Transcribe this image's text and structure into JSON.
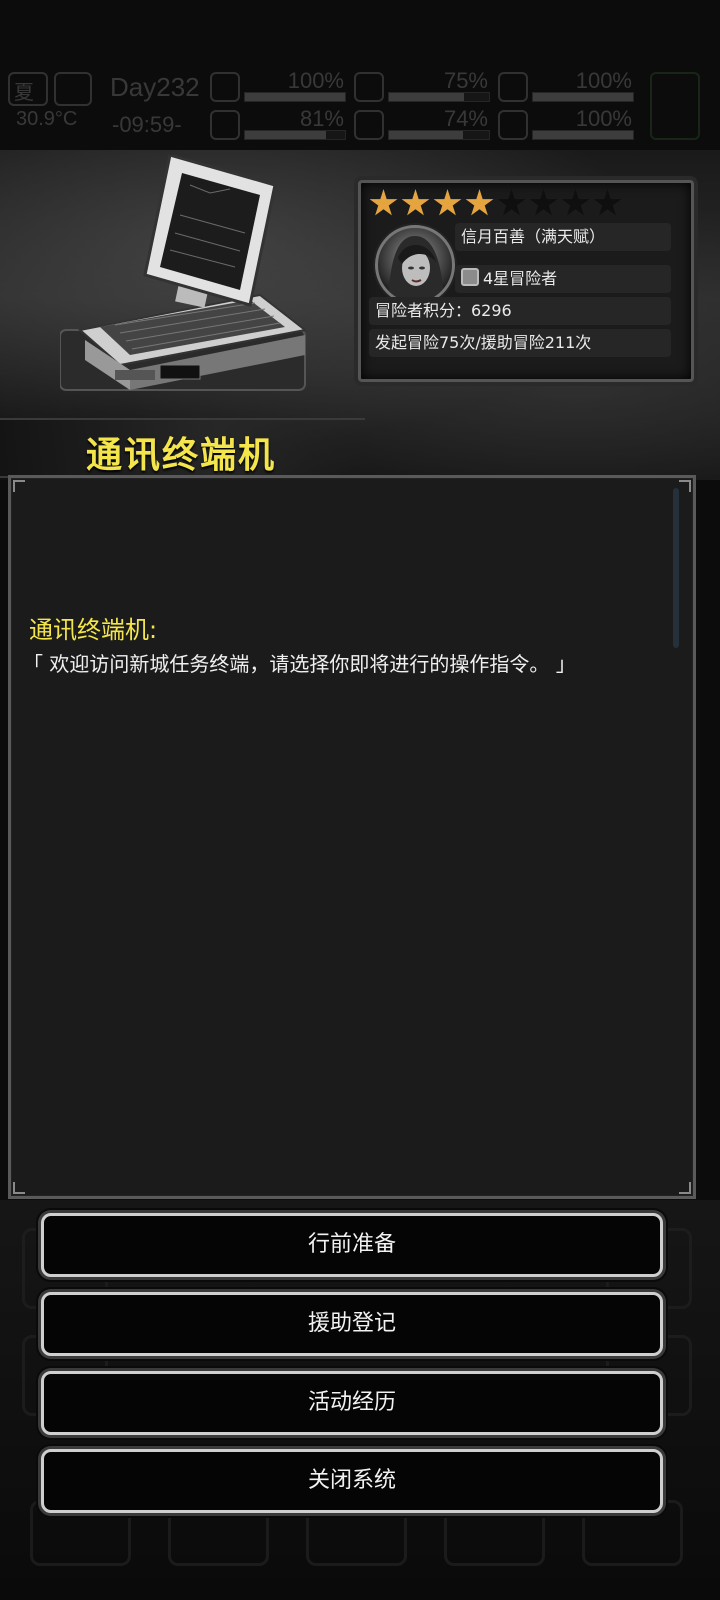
{
  "status_bar": {
    "season": "夏",
    "temperature": "30.9°C",
    "day": "Day232",
    "time": "-09:59-",
    "stats": [
      {
        "icon": "medkit-icon",
        "value": "100%",
        "level": 1.0
      },
      {
        "icon": "stomach-icon",
        "value": "75%",
        "level": 0.75
      },
      {
        "icon": "sleep-icon",
        "value": "100%",
        "level": 1.0
      },
      {
        "icon": "boot-icon",
        "value": "81%",
        "level": 0.81
      },
      {
        "icon": "water-drop-icon",
        "value": "74%",
        "level": 0.74
      },
      {
        "icon": "heart-icon",
        "value": "100%",
        "level": 1.0
      }
    ]
  },
  "profile": {
    "stars_total": 8,
    "stars_filled": 4,
    "name": "信月百善（满天赋）",
    "rank": "4星冒险者",
    "score_text": "冒险者积分：6296",
    "missions_text": "发起冒险75次/援助冒险211次"
  },
  "terminal": {
    "title": "通讯终端机",
    "speaker": "通讯终端机:",
    "message": "「 欢迎访问新城任务终端，请选择你即将进行的操作指令。 」"
  },
  "actions": [
    {
      "label": "行前准备"
    },
    {
      "label": "援助登记"
    },
    {
      "label": "活动经历"
    },
    {
      "label": "关闭系统"
    }
  ],
  "colors": {
    "title_yellow": "#f3e54b",
    "star_gold": "#e4a540",
    "panel_bg": "#1b1b1b",
    "button_border": "#cfcfcf"
  }
}
